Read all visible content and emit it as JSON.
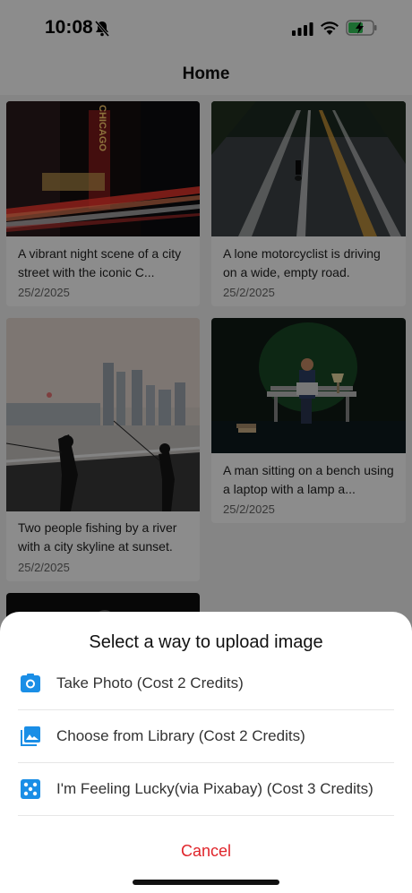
{
  "status_bar": {
    "time": "10:08"
  },
  "nav": {
    "title": "Home"
  },
  "feed": {
    "cards": [
      {
        "caption": "A vibrant night scene of a city street with the iconic C...",
        "date": "25/2/2025",
        "sign_text": "CHICAGO"
      },
      {
        "caption": "A lone motorcyclist is driving on a wide, empty road.",
        "date": "25/2/2025"
      },
      {
        "caption": "Two people fishing by a river with a city skyline at sunset.",
        "date": "25/2/2025"
      },
      {
        "caption": "A man sitting on a bench using a laptop with a lamp a...",
        "date": "25/2/2025"
      }
    ]
  },
  "sheet": {
    "title": "Select a way to upload image",
    "options": [
      {
        "label": "Take Photo (Cost 2 Credits)",
        "icon": "camera-icon"
      },
      {
        "label": "Choose from Library (Cost 2 Credits)",
        "icon": "photo-library-icon"
      },
      {
        "label": "I'm Feeling Lucky(via Pixabay) (Cost 3 Credits)",
        "icon": "dice-icon"
      }
    ],
    "cancel_label": "Cancel"
  },
  "colors": {
    "accent_blue": "#1a8ee6",
    "cancel_red": "#e0242a"
  }
}
